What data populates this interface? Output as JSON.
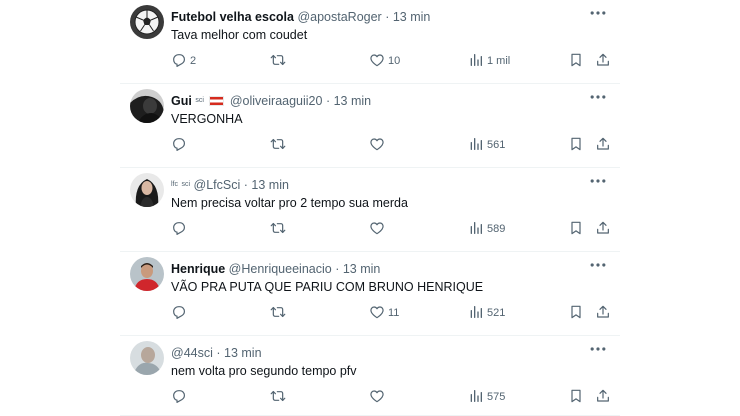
{
  "tweets": [
    {
      "name": "Futebol velha escola",
      "name_suffix": "",
      "handle": "@apostaRoger",
      "time": "13 min",
      "text": "Tava melhor com coudet",
      "replies": "2",
      "retweets": "",
      "likes": "10",
      "views": "1 mil",
      "avatar": "soccer-ball-logo"
    },
    {
      "name": "Gui",
      "name_suffix": "sci",
      "handle": "@oliveiraaguii20",
      "time": "13 min",
      "text": "VERGONHA",
      "replies": "",
      "retweets": "",
      "likes": "",
      "views": "561",
      "avatar": "dark-profile-photo",
      "flag": "red-white-red-flag"
    },
    {
      "name": "lfc",
      "name_suffix": "sci",
      "handle": "@LfcSci",
      "time": "13 min",
      "text": "Nem precisa voltar pro 2 tempo sua merda",
      "replies": "",
      "retweets": "",
      "likes": "",
      "views": "589",
      "avatar": "woman-photo"
    },
    {
      "name": "Henrique",
      "name_suffix": "",
      "handle": "@Henriqueeinacio",
      "time": "13 min",
      "text": "VÃO PRA PUTA QUE PARIU COM BRUNO HENRIQUE",
      "replies": "",
      "retweets": "",
      "likes": "11",
      "views": "521",
      "avatar": "man-red-shirt-photo"
    },
    {
      "name": "",
      "name_suffix": "",
      "handle": "@44sci",
      "time": "13 min",
      "text": "nem volta pro segundo tempo pfv",
      "replies": "",
      "retweets": "",
      "likes": "",
      "views": "575",
      "avatar": "blurred-photo"
    }
  ],
  "ui": {
    "separator": "·",
    "icons": {
      "reply": "reply-icon",
      "retweet": "retweet-icon",
      "like": "heart-icon",
      "views": "bar-chart-icon",
      "bookmark": "bookmark-icon",
      "share": "share-icon",
      "more": "more-dots-icon"
    },
    "colors": {
      "text": "#0f1419",
      "secondary": "#536471",
      "divider": "#eff3f4"
    }
  }
}
